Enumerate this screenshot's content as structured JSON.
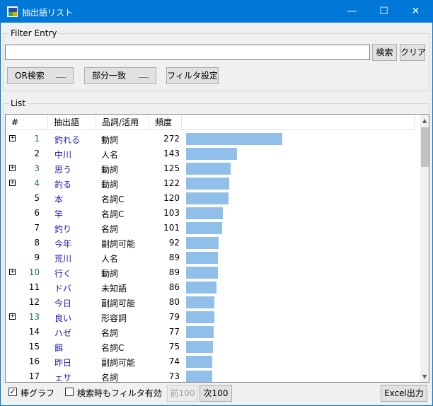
{
  "window": {
    "title": "抽出語リスト",
    "min": "—",
    "max": "☐",
    "close": "✕"
  },
  "filter": {
    "legend": "Filter Entry",
    "search_value": "",
    "search_btn": "検索",
    "clear_btn": "クリア",
    "mode_dd": "OR検索",
    "match_dd": "部分一致",
    "settings_btn": "フィルタ設定"
  },
  "list": {
    "legend": "List",
    "headers": [
      "#",
      "抽出語",
      "品詞/活用",
      "頻度"
    ],
    "rows": [
      {
        "n": "1",
        "w": "釣れる",
        "p": "動詞",
        "f": 272,
        "exp": true
      },
      {
        "n": "2",
        "w": "中川",
        "p": "人名",
        "f": 143,
        "exp": false
      },
      {
        "n": "3",
        "w": "思う",
        "p": "動詞",
        "f": 125,
        "exp": true
      },
      {
        "n": "4",
        "w": "釣る",
        "p": "動詞",
        "f": 122,
        "exp": true
      },
      {
        "n": "5",
        "w": "本",
        "p": "名詞C",
        "f": 120,
        "exp": false
      },
      {
        "n": "6",
        "w": "竿",
        "p": "名詞C",
        "f": 103,
        "exp": false
      },
      {
        "n": "7",
        "w": "釣り",
        "p": "名詞",
        "f": 101,
        "exp": false
      },
      {
        "n": "8",
        "w": "今年",
        "p": "副詞可能",
        "f": 92,
        "exp": false
      },
      {
        "n": "9",
        "w": "荒川",
        "p": "人名",
        "f": 89,
        "exp": false
      },
      {
        "n": "10",
        "w": "行く",
        "p": "動詞",
        "f": 89,
        "exp": true
      },
      {
        "n": "11",
        "w": "ドバ",
        "p": "未知語",
        "f": 86,
        "exp": false
      },
      {
        "n": "12",
        "w": "今日",
        "p": "副詞可能",
        "f": 80,
        "exp": false
      },
      {
        "n": "13",
        "w": "良い",
        "p": "形容詞",
        "f": 79,
        "exp": true
      },
      {
        "n": "14",
        "w": "ハゼ",
        "p": "名詞",
        "f": 77,
        "exp": false
      },
      {
        "n": "15",
        "w": "餌",
        "p": "名詞C",
        "f": 75,
        "exp": false
      },
      {
        "n": "16",
        "w": "昨日",
        "p": "副詞可能",
        "f": 74,
        "exp": false
      },
      {
        "n": "17",
        "w": "ェサ",
        "p": "名詞",
        "f": 73,
        "exp": false
      }
    ]
  },
  "footer": {
    "bar_graph_check": "✓",
    "bar_graph_label": "棒グラフ",
    "filter_on_search_label": "検索時もフィルタ有効",
    "prev_btn": "前100",
    "next_btn": "次100",
    "excel_btn": "Excel出力"
  },
  "colors": {
    "accent": "#0078d7",
    "bar": "#90c0ea",
    "word": "#1a1ab4",
    "expandable_num": "#1a7a3a"
  }
}
